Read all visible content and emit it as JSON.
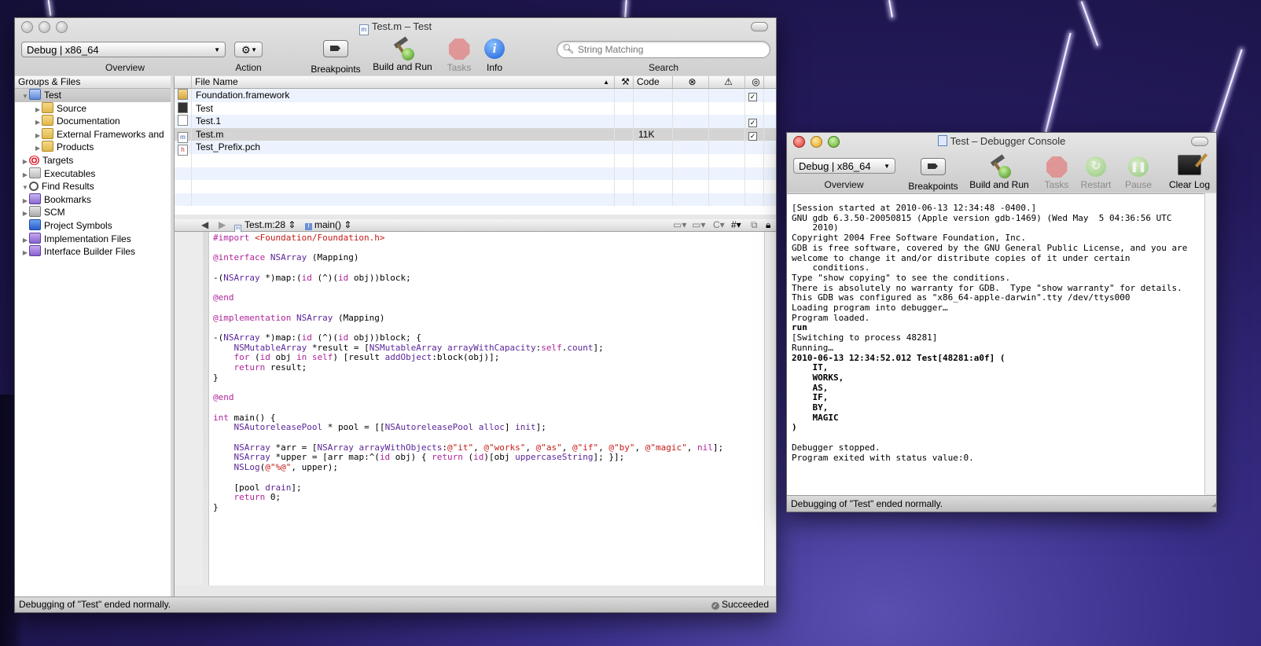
{
  "desktop": {
    "description_colors": {
      "sky": "#241a5c",
      "lightning": "#f4f0ff"
    }
  },
  "main_window": {
    "title": "Test.m – Test",
    "config_popup": "Debug | x86_64",
    "toolbar": {
      "overview": "Overview",
      "action": "Action",
      "breakpoints": "Breakpoints",
      "build_and_run": "Build and Run",
      "tasks": "Tasks",
      "info": "Info",
      "search": "Search",
      "search_placeholder": "String Matching"
    },
    "sidebar": {
      "header": "Groups & Files",
      "items": [
        {
          "label": "Test",
          "icon": "project-icon",
          "level": 0,
          "expanded": true,
          "selected": true
        },
        {
          "label": "Source",
          "icon": "folder-icon",
          "level": 1
        },
        {
          "label": "Documentation",
          "icon": "folder-icon",
          "level": 1
        },
        {
          "label": "External Frameworks and",
          "icon": "folder-icon",
          "level": 1
        },
        {
          "label": "Products",
          "icon": "folder-icon",
          "level": 1
        },
        {
          "label": "Targets",
          "icon": "target-icon",
          "level": 0
        },
        {
          "label": "Executables",
          "icon": "executable-icon",
          "level": 0
        },
        {
          "label": "Find Results",
          "icon": "magnifier-icon",
          "level": 0,
          "expanded": true
        },
        {
          "label": "Bookmarks",
          "icon": "bookmark-icon",
          "level": 0
        },
        {
          "label": "SCM",
          "icon": "scm-icon",
          "level": 0
        },
        {
          "label": "Project Symbols",
          "icon": "cube-icon",
          "level": 0,
          "no_disclosure": true
        },
        {
          "label": "Implementation Files",
          "icon": "smart-group-icon",
          "level": 0
        },
        {
          "label": "Interface Builder Files",
          "icon": "smart-group-icon",
          "level": 0
        }
      ]
    },
    "file_list": {
      "columns": [
        "File Name",
        "Code"
      ],
      "rows": [
        {
          "name": "Foundation.framework",
          "code": "",
          "checked": true
        },
        {
          "name": "Test",
          "code": "",
          "checked": false
        },
        {
          "name": "Test.1",
          "code": "",
          "checked": true
        },
        {
          "name": "Test.m",
          "code": "11K",
          "checked": true,
          "selected": true
        },
        {
          "name": "Test_Prefix.pch",
          "code": "",
          "checked": false
        }
      ]
    },
    "editor_nav": {
      "file": "Test.m:28",
      "function": "main()"
    },
    "code_lines": [
      "#import <Foundation/Foundation.h>",
      "",
      "@interface NSArray (Mapping)",
      "",
      "-(NSArray *)map:(id (^)(id obj))block;",
      "",
      "@end",
      "",
      "@implementation NSArray (Mapping)",
      "",
      "-(NSArray *)map:(id (^)(id obj))block; {",
      "    NSMutableArray *result = [NSMutableArray arrayWithCapacity:self.count];",
      "    for (id obj in self) [result addObject:block(obj)];",
      "    return result;",
      "}",
      "",
      "@end",
      "",
      "int main() {",
      "    NSAutoreleasePool * pool = [[NSAutoreleasePool alloc] init];",
      "",
      "    NSArray *arr = [NSArray arrayWithObjects:@\"it\", @\"works\", @\"as\", @\"if\", @\"by\", @\"magic\", nil];",
      "    NSArray *upper = [arr map:^(id obj) { return (id)[obj uppercaseString]; }];",
      "    NSLog(@\"%@\", upper);",
      "",
      "    [pool drain];",
      "    return 0;",
      "}"
    ],
    "status_left": "Debugging of \"Test\" ended normally.",
    "status_right": "Succeeded"
  },
  "console_window": {
    "title": "Test – Debugger Console",
    "config_popup": "Debug | x86_64",
    "toolbar": {
      "overview": "Overview",
      "breakpoints": "Breakpoints",
      "build_and_run": "Build and Run",
      "tasks": "Tasks",
      "restart": "Restart",
      "pause": "Pause",
      "clear_log": "Clear Log"
    },
    "output_normal": "[Session started at 2010-06-13 12:34:48 -0400.]\nGNU gdb 6.3.50-20050815 (Apple version gdb-1469) (Wed May  5 04:36:56 UTC\n    2010)\nCopyright 2004 Free Software Foundation, Inc.\nGDB is free software, covered by the GNU General Public License, and you are\nwelcome to change it and/or distribute copies of it under certain\n    conditions.\nType \"show copying\" to see the conditions.\nThere is absolutely no warranty for GDB.  Type \"show warranty\" for details.\nThis GDB was configured as \"x86_64-apple-darwin\".tty /dev/ttys000\nLoading program into debugger…\nProgram loaded.",
    "output_run": "run",
    "output_mid": "[Switching to process 48281]\nRunning…",
    "output_log": "2010-06-13 12:34:52.012 Test[48281:a0f] (\n    IT,\n    WORKS,\n    AS,\n    IF,\n    BY,\n    MAGIC\n)",
    "output_end": "\nDebugger stopped.\nProgram exited with status value:0.",
    "status": "Debugging of \"Test\" ended normally."
  }
}
